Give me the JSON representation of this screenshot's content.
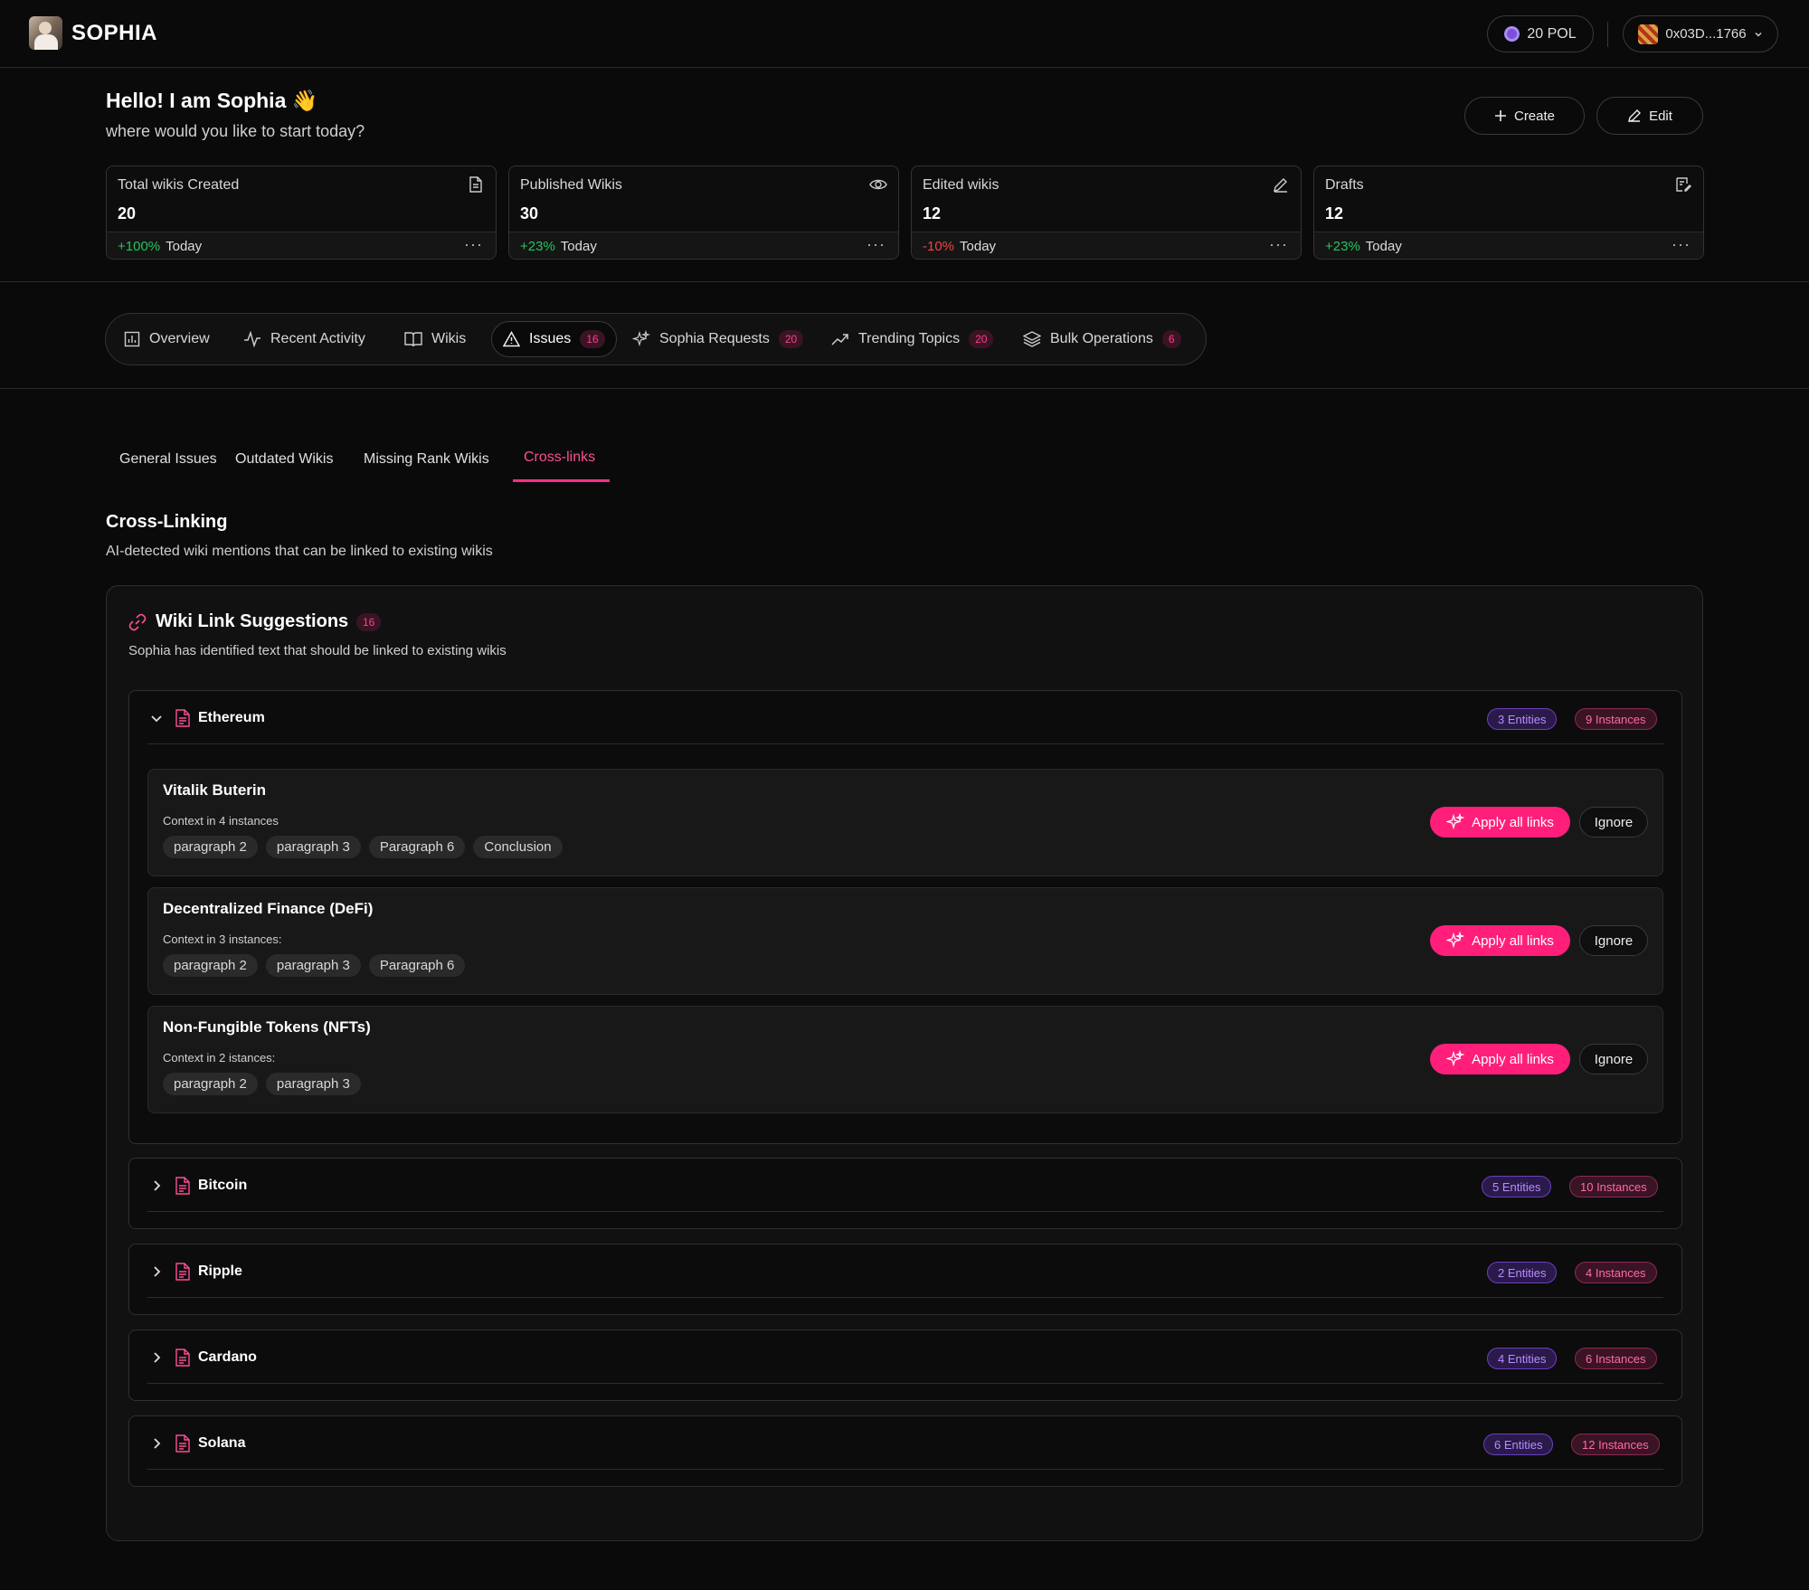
{
  "app": {
    "brand": "SOPHIA"
  },
  "header": {
    "balance": "20 POL",
    "wallet": "0x03D...1766"
  },
  "greeting": {
    "title": "Hello! I am Sophia 👋",
    "subtitle": "where would you like to start today?"
  },
  "actions": {
    "create": "Create",
    "edit": "Edit"
  },
  "stats": [
    {
      "label": "Total wikis Created",
      "value": "20",
      "change": "+100%",
      "trend": "up",
      "period": "Today",
      "icon": "document-icon"
    },
    {
      "label": "Published Wikis",
      "value": "30",
      "change": "+23%",
      "trend": "up",
      "period": "Today",
      "icon": "eye-icon"
    },
    {
      "label": "Edited wikis",
      "value": "12",
      "change": "-10%",
      "trend": "down",
      "period": "Today",
      "icon": "pencil-icon"
    },
    {
      "label": "Drafts",
      "value": "12",
      "change": "+23%",
      "trend": "up",
      "period": "Today",
      "icon": "draft-icon"
    }
  ],
  "main_tabs": [
    {
      "label": "Overview",
      "icon": "chart-icon"
    },
    {
      "label": "Recent Activity",
      "icon": "activity-icon"
    },
    {
      "label": "Wikis",
      "icon": "book-icon"
    },
    {
      "label": "Issues",
      "badge": "16",
      "icon": "warning-icon",
      "active": true
    },
    {
      "label": "Sophia Requests",
      "badge": "20",
      "icon": "sparkle-icon"
    },
    {
      "label": "Trending Topics",
      "badge": "20",
      "icon": "trending-icon"
    },
    {
      "label": "Bulk Operations",
      "badge": "6",
      "icon": "layers-icon"
    }
  ],
  "sub_tabs": [
    {
      "label": "General Issues"
    },
    {
      "label": "Outdated Wikis"
    },
    {
      "label": "Missing Rank Wikis"
    },
    {
      "label": "Cross-links",
      "active": true
    }
  ],
  "section": {
    "title": "Cross-Linking",
    "subtitle": "AI-detected wiki mentions that can be linked to existing wikis"
  },
  "panel": {
    "title": "Wiki Link Suggestions",
    "badge": "16",
    "subtitle": "Sophia has identified text that should be linked to existing wikis",
    "apply_label": "Apply all links",
    "ignore_label": "Ignore",
    "groups": [
      {
        "name": "Ethereum",
        "entities_label": "3 Entities",
        "instances_label": "9 Instances",
        "expanded": true,
        "entities": [
          {
            "name": "Vitalik Buterin",
            "context": "Context in 4 instances",
            "chips": [
              "paragraph 2",
              "paragraph 3",
              "Paragraph 6",
              "Conclusion"
            ]
          },
          {
            "name": "Decentralized Finance (DeFi)",
            "context": "Context in 3 instances:",
            "chips": [
              "paragraph 2",
              "paragraph 3",
              "Paragraph 6"
            ]
          },
          {
            "name": "Non-Fungible Tokens (NFTs)",
            "context": "Context in 2 istances:",
            "chips": [
              "paragraph 2",
              "paragraph 3"
            ]
          }
        ]
      },
      {
        "name": "Bitcoin",
        "entities_label": "5 Entities",
        "instances_label": "10 Instances",
        "expanded": false
      },
      {
        "name": "Ripple",
        "entities_label": "2 Entities",
        "instances_label": "4 Instances",
        "expanded": false
      },
      {
        "name": "Cardano",
        "entities_label": "4 Entities",
        "instances_label": "6 Instances",
        "expanded": false
      },
      {
        "name": "Solana",
        "entities_label": "6 Entities",
        "instances_label": "12 Instances",
        "expanded": false
      }
    ]
  },
  "colors": {
    "accent": "#ff1f7a",
    "positive": "#22c55e",
    "negative": "#ef4444",
    "entity_pill": "#b98cff",
    "instance_pill": "#ff6aa7"
  }
}
